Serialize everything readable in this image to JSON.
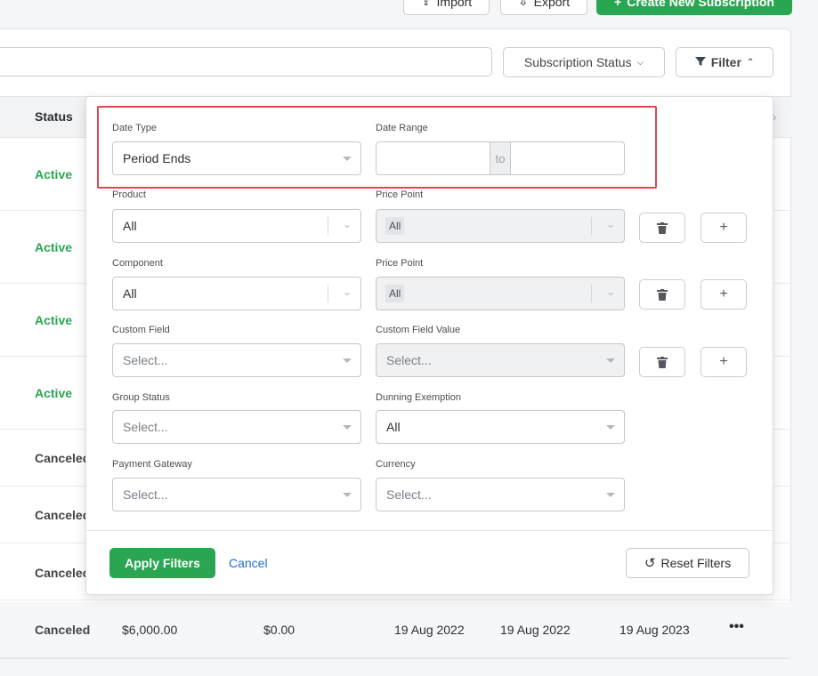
{
  "toolbar": {
    "import_label": "Import",
    "export_label": "Export",
    "create_label": "Create New Subscription"
  },
  "filters_bar": {
    "subscription_status_label": "Subscription Status",
    "filter_label": "Filter"
  },
  "table": {
    "status_header": "Status",
    "rows": [
      {
        "status": "Active"
      },
      {
        "status": "Active"
      },
      {
        "status": "Active"
      },
      {
        "status": "Active"
      },
      {
        "status": "Canceled"
      },
      {
        "status": "Canceled"
      },
      {
        "status": "Canceled"
      },
      {
        "status": "Canceled",
        "amount": "$6,000.00",
        "balance": "$0.00",
        "date1": "19 Aug 2022",
        "date2": "19 Aug 2022",
        "date3": "19 Aug 2023"
      }
    ]
  },
  "panel": {
    "date_type": {
      "label": "Date Type",
      "value": "Period Ends"
    },
    "date_range": {
      "label": "Date Range",
      "to": "to"
    },
    "product": {
      "label": "Product",
      "value": "All"
    },
    "product_price_point": {
      "label": "Price Point",
      "value": "All"
    },
    "component": {
      "label": "Component",
      "value": "All"
    },
    "component_price_point": {
      "label": "Price Point",
      "value": "All"
    },
    "custom_field": {
      "label": "Custom Field",
      "placeholder": "Select..."
    },
    "custom_field_value": {
      "label": "Custom Field Value",
      "placeholder": "Select..."
    },
    "group_status": {
      "label": "Group Status",
      "placeholder": "Select..."
    },
    "dunning_exemption": {
      "label": "Dunning Exemption",
      "value": "All"
    },
    "payment_gateway": {
      "label": "Payment Gateway",
      "placeholder": "Select..."
    },
    "currency": {
      "label": "Currency",
      "placeholder": "Select..."
    },
    "apply_label": "Apply Filters",
    "cancel_label": "Cancel",
    "reset_label": "Reset Filters"
  },
  "colors": {
    "primary": "#2aa652",
    "link": "#1f6fd1",
    "highlight": "#e0474c"
  }
}
